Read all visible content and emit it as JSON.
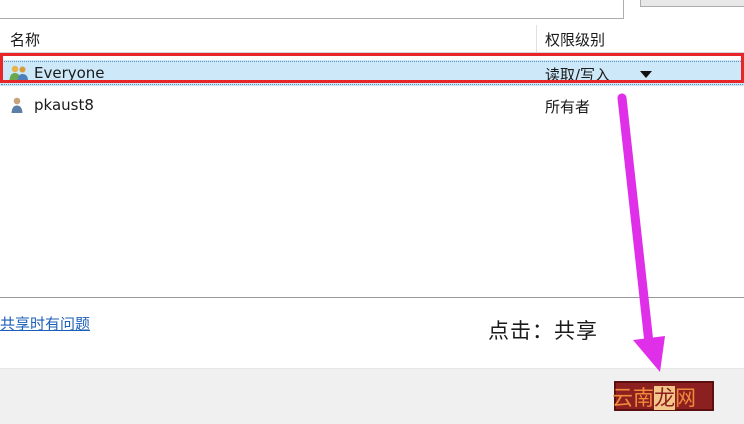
{
  "header": {
    "columns": [
      {
        "label": "名称"
      },
      {
        "label": "权限级别"
      }
    ]
  },
  "rows": [
    {
      "name": "Everyone",
      "permission": "读取/写入",
      "icon": "users-group-icon",
      "selected": true,
      "has_dropdown": true
    },
    {
      "name": "pkaust8",
      "permission": "所有者",
      "icon": "user-icon",
      "selected": false,
      "has_dropdown": false
    }
  ],
  "help_link": "共享时有问题",
  "annotation": "点击：共享",
  "watermark": {
    "part1": "云南",
    "part2": "龙",
    "part3": "网"
  },
  "colors": {
    "selection": "#cde8f8",
    "highlight_border": "#e8262a",
    "arrow": "#e02fe8",
    "link": "#1c5fb8",
    "button": "#8c1f1f"
  }
}
